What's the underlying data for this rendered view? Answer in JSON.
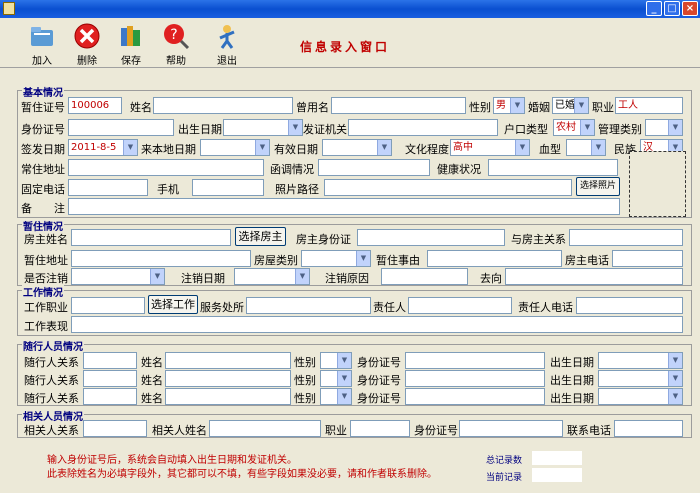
{
  "window": {
    "title": "",
    "minimize": "_",
    "maximize": "□",
    "close": "×"
  },
  "toolbar": {
    "add": "加入",
    "delete": "删除",
    "save": "保存",
    "help": "帮助",
    "exit": "退出",
    "heading": "信息录入窗口"
  },
  "basic": {
    "title": "基本情况",
    "temp_id_label": "暂住证号",
    "temp_id_value": "100006",
    "name_label": "姓名",
    "alias_label": "曾用名",
    "gender_label": "性别",
    "gender_value": "男",
    "marital_label": "婚姻",
    "marital_value": "已婚",
    "job_label": "职业",
    "job_value": "工人",
    "idcard_label": "身份证号",
    "birth_label": "出生日期",
    "issuer_label": "发证机关",
    "hukou_type_label": "户口类型",
    "hukou_type_value": "农村",
    "mgmt_type_label": "管理类别",
    "sign_date_label": "签发日期",
    "sign_date_value": "2011-8-5",
    "arrival_date_label": "来本地日期",
    "valid_date_label": "有效日期",
    "education_label": "文化程度",
    "education_value": "高中",
    "blood_label": "血型",
    "ethnic_label": "民族",
    "ethnic_value": "汉",
    "home_addr_label": "常住地址",
    "function_label": "函调情况",
    "health_label": "健康状况",
    "phone_label": "固定电话",
    "mobile_label": "手机",
    "photo_path_label": "照片路径",
    "choose_photo": "选择照片",
    "remark_label": "备　　注"
  },
  "residence": {
    "title": "暂住情况",
    "landlord_name_label": "房主姓名",
    "choose_landlord": "选择房主",
    "landlord_id_label": "房主身份证",
    "relation_label": "与房主关系",
    "addr_label": "暂住地址",
    "house_type_label": "房屋类别",
    "reason_label": "暂住事由",
    "landlord_phone_label": "房主电话",
    "cancelled_label": "是否注销",
    "cancel_date_label": "注销日期",
    "cancel_reason_label": "注销原因",
    "destination_label": "去向"
  },
  "work": {
    "title": "工作情况",
    "job_label": "工作职业",
    "choose_work": "选择工作",
    "place_label": "服务处所",
    "resp_label": "责任人",
    "resp_phone_label": "责任人电话",
    "perf_label": "工作表现"
  },
  "followers": {
    "title": "随行人员情况",
    "rows": [
      {
        "rel": "随行人关系",
        "name": "姓名",
        "gender": "性别",
        "id": "身份证号",
        "birth": "出生日期"
      },
      {
        "rel": "随行人关系",
        "name": "姓名",
        "gender": "性别",
        "id": "身份证号",
        "birth": "出生日期"
      },
      {
        "rel": "随行人关系",
        "name": "姓名",
        "gender": "性别",
        "id": "身份证号",
        "birth": "出生日期"
      }
    ]
  },
  "related": {
    "title": "相关人员情况",
    "rel_label": "相关人关系",
    "name_label": "相关人姓名",
    "job_label": "职业",
    "id_label": "身份证号",
    "phone_label": "联系电话"
  },
  "footer": {
    "line1": "输入身份证号后，系统会自动填入出生日期和发证机关。",
    "line2": "此表除姓名为必填字段外，其它都可以不填，有些字段如果没必要，请和作者联系删除。",
    "total_label": "总记录数",
    "current_label": "当前记录"
  },
  "colors": {
    "accent": "#C00000",
    "group_title": "#000080",
    "bg": "#ECE9D8"
  }
}
